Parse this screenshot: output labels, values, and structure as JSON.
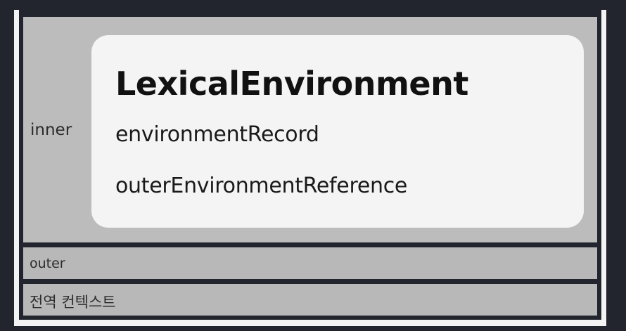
{
  "contexts": {
    "inner_label": "inner",
    "outer_label": "outer",
    "global_label": "전역 컨텍스트"
  },
  "lexical_environment": {
    "title": "LexicalEnvironment",
    "fields": [
      "environmentRecord",
      "outerEnvironmentReference"
    ]
  },
  "colors": {
    "background": "#22252d",
    "frame": "#f3f3f3",
    "context_box": "#bdbcbc",
    "card": "#f4f4f5"
  }
}
